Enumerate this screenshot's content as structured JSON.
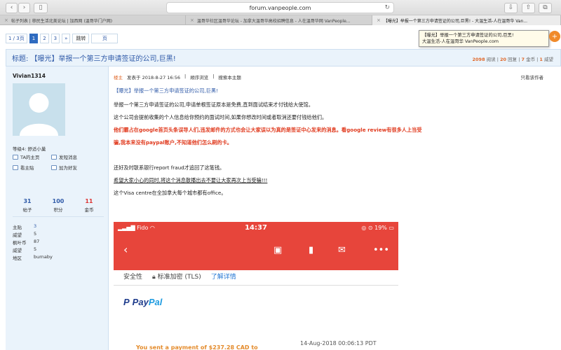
{
  "browser": {
    "url": "forum.vanpeople.com",
    "tabs": [
      {
        "label": "帖子列表 | 移民生活北美论坛 | 加西网 (温哥华门户网)"
      },
      {
        "label": "温哥华社区温哥华论坛 - 加拿大温哥华高校招聘信息 - 人在温哥华网 VanPeople..."
      },
      {
        "label": "【曝光】举报一个第三方申请签证的公司,巨黑! - 大温生活-人在温哥华 Van..."
      }
    ]
  },
  "tooltip": {
    "line1": "【曝光】举报一个第三方申请签证的公司,巨黑!",
    "line2": "大温生活-人在温哥华 VanPeople.com"
  },
  "pager": {
    "page_info": "1 / 3页",
    "pages": [
      "1",
      "2",
      "3",
      "»"
    ],
    "jump_label": "跳转",
    "suffix": "页"
  },
  "thread": {
    "title": "标题: 【曝光】举报一个第三方申请签证的公司,巨黑!",
    "views": "2098",
    "views_label": "阅读",
    "replies": "20",
    "replies_label": "回复",
    "coins": "7",
    "coins_label": "金币",
    "prestige": "1",
    "prestige_label": "威望"
  },
  "user": {
    "name": "Vivian1314",
    "level": "等级4: 舒适小巢",
    "links": [
      "TA的主页",
      "发短消息",
      "看主贴",
      "加为好友"
    ],
    "stats": [
      {
        "value": "31",
        "label": "帖子"
      },
      {
        "value": "100",
        "label": "积分"
      },
      {
        "value": "11",
        "label": "金币"
      }
    ],
    "details": [
      {
        "key": "主贴",
        "value": "3"
      },
      {
        "key": "威望",
        "value": "5"
      },
      {
        "key": "枫叶币",
        "value": "87"
      },
      {
        "key": "威望",
        "value": "5"
      },
      {
        "key": "地区",
        "value": "burnaby"
      }
    ]
  },
  "post": {
    "op_tag": "楼主",
    "published": "发表于 2018-8-27 16:56",
    "order": "顺序浏览",
    "search": "搜索本主题",
    "only_author": "只看该作者",
    "heading": "【曝光】举报一个第三方申请签证的公司,巨黑!",
    "line1": "举报一个第三方申请签证的公司,申请单根签证原本是免费,直到面试结束才付钱给大使馆。",
    "line2": "这个公司会提前收集的个人信息给你预约的面试时间,如果你想改时间或者取消还要付钱给他们。",
    "line3": "他们霸占在google首页头条误导人们,违发邮件的方式也会让大家误以为真的是签证中心发来的消息。看google review有很多人上当受",
    "line4": "骗,我本来没有paypal账户,不知道他们怎么刷的卡。",
    "line5": "还好及时联系银行report fraud才追回了这笔钱。",
    "line6": "希望大家小心的同时,将这个消息散播出去不要让大家再次上当受骗!!!",
    "line7": "这个Visa centre在全加拿大每个城市都有office。"
  },
  "phone": {
    "carrier": "Fido",
    "time": "14:37",
    "battery": "19%",
    "security_label": "安全性",
    "encryption": "标准加密 (TLS)",
    "learn_more": "了解详情",
    "paypal_text": "PayPal",
    "payment": "You sent a payment of $237.28 CAD to",
    "date": "14-Aug-2018 00:06:13 PDT"
  },
  "colors": {
    "accent_blue": "#2f5aa8",
    "warning_red": "#e03a1e",
    "phone_header_red": "#e7453b",
    "stat_orange": "#e0692b"
  }
}
